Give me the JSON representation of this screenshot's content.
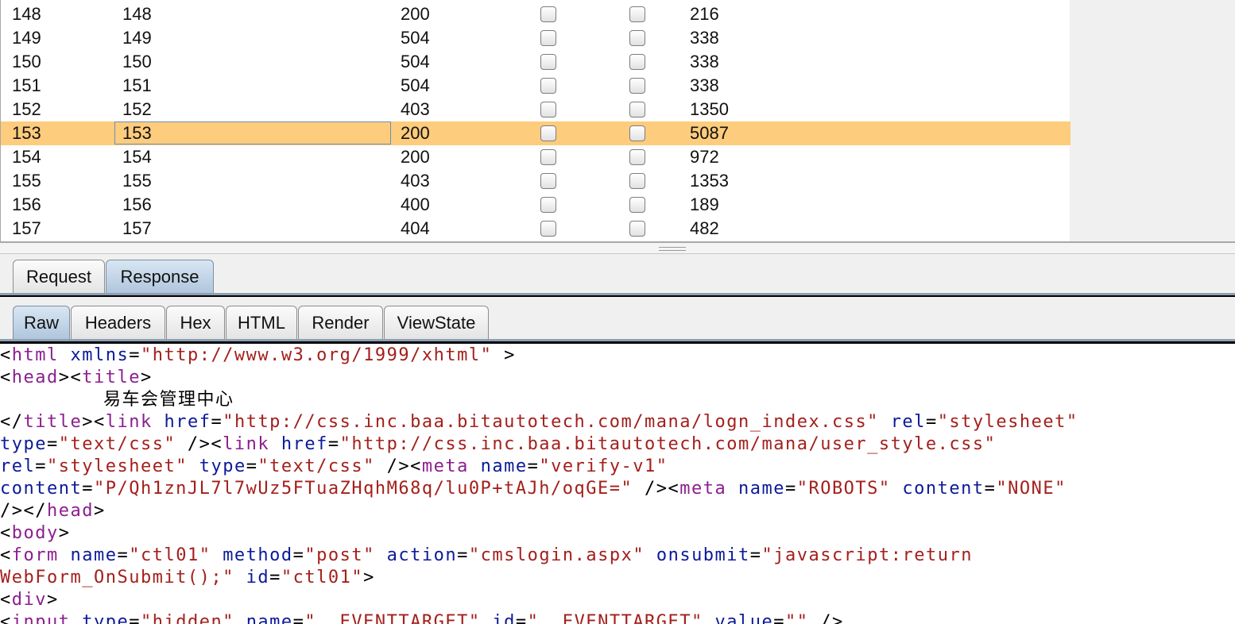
{
  "table": {
    "rows": [
      {
        "c0": "148",
        "c1": "148",
        "c2": "200",
        "c5": "216",
        "selected": false
      },
      {
        "c0": "149",
        "c1": "149",
        "c2": "504",
        "c5": "338",
        "selected": false
      },
      {
        "c0": "150",
        "c1": "150",
        "c2": "504",
        "c5": "338",
        "selected": false
      },
      {
        "c0": "151",
        "c1": "151",
        "c2": "504",
        "c5": "338",
        "selected": false
      },
      {
        "c0": "152",
        "c1": "152",
        "c2": "403",
        "c5": "1350",
        "selected": false
      },
      {
        "c0": "153",
        "c1": "153",
        "c2": "200",
        "c5": "5087",
        "selected": true
      },
      {
        "c0": "154",
        "c1": "154",
        "c2": "200",
        "c5": "972",
        "selected": false
      },
      {
        "c0": "155",
        "c1": "155",
        "c2": "403",
        "c5": "1353",
        "selected": false
      },
      {
        "c0": "156",
        "c1": "156",
        "c2": "400",
        "c5": "189",
        "selected": false
      },
      {
        "c0": "157",
        "c1": "157",
        "c2": "404",
        "c5": "482",
        "selected": false
      }
    ]
  },
  "message_tabs": {
    "request": "Request",
    "response": "Response",
    "active": "response"
  },
  "view_tabs": {
    "raw": "Raw",
    "headers": "Headers",
    "hex": "Hex",
    "html": "HTML",
    "render": "Render",
    "viewstate": "ViewState",
    "active": "raw"
  },
  "code": {
    "l1": {
      "t1": "<",
      "t2": "html",
      "a1": "xmlns",
      "eq": "=",
      "v1": "\"http://www.w3.org/1999/xhtml\"",
      "t3": " >"
    },
    "l2": {
      "t1": "<",
      "t2": "head",
      "t3": "><",
      "t4": "title",
      "t5": ">"
    },
    "l3": {
      "text": "易车会管理中心"
    },
    "l4": {
      "t1": "</",
      "t2": "title",
      "t3": "><",
      "t4": "link",
      "a1": "href",
      "e1": "=",
      "v1": "\"http://css.inc.baa.bitautotech.com/mana/logn_index.css\"",
      "a2": "rel",
      "e2": "=",
      "v2": "\"stylesheet\""
    },
    "l5": {
      "a1": "type",
      "e1": "=",
      "v1": "\"text/css\"",
      "t1": " /><",
      "t2": "link",
      "a2": "href",
      "e2": "=",
      "v2": "\"http://css.inc.baa.bitautotech.com/mana/user_style.css\""
    },
    "l6": {
      "a1": "rel",
      "e1": "=",
      "v1": "\"stylesheet\"",
      "a2": "type",
      "e2": "=",
      "v2": "\"text/css\"",
      "t1": " /><",
      "t2": "meta",
      "a3": "name",
      "e3": "=",
      "v3": "\"verify-v1\""
    },
    "l7": {
      "a1": "content",
      "e1": "=",
      "v1": "\"P/Qh1znJL7l7wUz5FTuaZHqhM68q/lu0P+tAJh/oqGE=\"",
      "t1": " /><",
      "t2": "meta",
      "a2": "name",
      "e2": "=",
      "v2": "\"ROBOTS\"",
      "a3": "content",
      "e3": "=",
      "v3": "\"NONE\""
    },
    "l8": {
      "t1": "/></",
      "t2": "head",
      "t3": ">"
    },
    "l9": {
      "t1": "<",
      "t2": "body",
      "t3": ">"
    },
    "l10": {
      "t1": "<",
      "t2": "form",
      "a1": "name",
      "e1": "=",
      "v1": "\"ctl01\"",
      "a2": "method",
      "e2": "=",
      "v2": "\"post\"",
      "a3": "action",
      "e3": "=",
      "v3": "\"cmslogin.aspx\"",
      "a4": "onsubmit",
      "e4": "=",
      "v4": "\"javascript:return"
    },
    "l11": {
      "v1": "WebForm_OnSubmit();\"",
      "a1": "id",
      "e1": "=",
      "v2": "\"ctl01\"",
      "t1": ">"
    },
    "l12": {
      "t1": "<",
      "t2": "div",
      "t3": ">"
    },
    "l13": {
      "t1": "<",
      "t2": "input",
      "a1": "type",
      "e1": "=",
      "v1": "\"hidden\"",
      "a2": "name",
      "e2": "=",
      "v2": "\"__EVENTTARGET\"",
      "a3": "id",
      "e3": "=",
      "v3": "\"__EVENTTARGET\"",
      "a4": "value",
      "e4": "=",
      "v4": "\"\"",
      "t3": " />"
    }
  }
}
